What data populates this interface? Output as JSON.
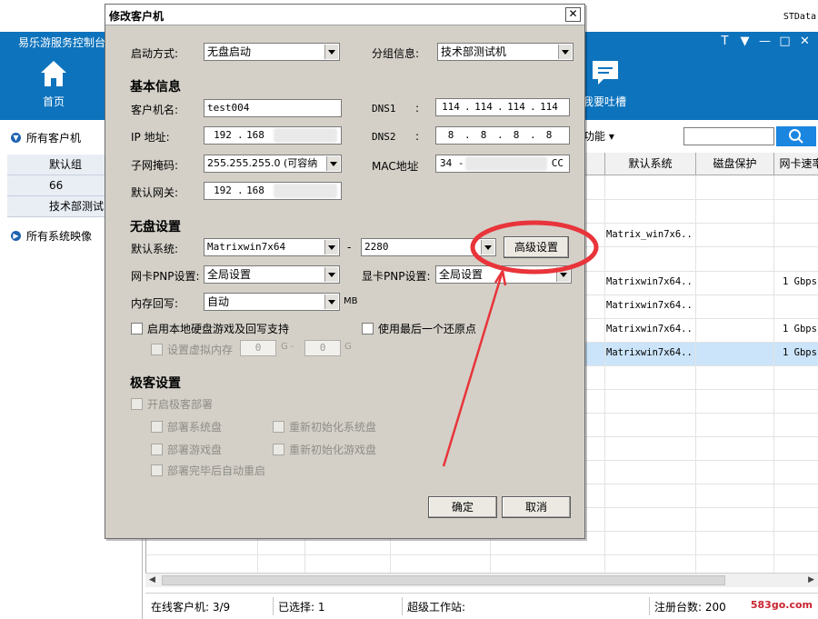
{
  "app": {
    "brand_corner": "STData",
    "title": "易乐游服务控制台",
    "nav": {
      "home": "首页",
      "feedback": "我要吐槽"
    },
    "window_controls": {
      "skin": "T",
      "menu": "▼",
      "minimize": "—",
      "maximize": "□",
      "close": "✕"
    },
    "sidebar": {
      "all_clients": "所有客户机",
      "groups": [
        "默认组",
        "66",
        "技术部测试"
      ],
      "all_images": "所有系统映像"
    },
    "toolbar": {
      "function_menu": "功能 ▾",
      "search_placeholder": ""
    },
    "grid": {
      "headers": [
        "默认系统",
        "磁盘保护",
        "网卡速率"
      ],
      "rows": [
        {
          "system": "",
          "speed": ""
        },
        {
          "system": "Matrix_win7x6...",
          "speed": ""
        },
        {
          "system": "",
          "speed": ""
        },
        {
          "system": "Matrixwin7x64...",
          "speed": "1 Gbps"
        },
        {
          "system": "Matrixwin7x64...",
          "speed": ""
        },
        {
          "system": "Matrixwin7x64...",
          "speed": "1 Gbps"
        },
        {
          "system": "Matrixwin7x64...",
          "speed": "1 Gbps"
        }
      ]
    },
    "statusbar": {
      "online": "在线客户机: 3/9",
      "selected": "已选择: 1",
      "super_ws": "超级工作站:",
      "registered": "注册台数: 200",
      "watermark": "583go.com"
    }
  },
  "dialog": {
    "title": "修改客户机",
    "close": "✕",
    "boot_mode": {
      "label": "启动方式:",
      "value": "无盘启动"
    },
    "group_info": {
      "label": "分组信息:",
      "value": "技术部测试机"
    },
    "basic_section": "基本信息",
    "client_name": {
      "label": "客户机名:",
      "value": "test004"
    },
    "ip": {
      "label": "IP  地址:",
      "octets": [
        "192",
        "168"
      ]
    },
    "subnet": {
      "label": "子网掩码:",
      "value": "255.255.255.0   (可容纳"
    },
    "gateway": {
      "label": "默认网关:",
      "octets": [
        "192",
        "168"
      ]
    },
    "dns1": {
      "label": "DNS1",
      "colon": ":",
      "octets": [
        "114",
        "114",
        "114",
        "114"
      ]
    },
    "dns2": {
      "label": "DNS2",
      "colon": ":",
      "octets": [
        "8",
        "8",
        "8",
        "8"
      ]
    },
    "mac": {
      "label": "MAC地址",
      "colon": ":",
      "start": "34 -",
      "end": "CC"
    },
    "diskless_section": "无盘设置",
    "default_system": {
      "label": "默认系统:",
      "value": "Matrixwin7x64",
      "dash": "-",
      "version": "2280"
    },
    "advanced_button": "高级设置",
    "nic_pnp": {
      "label": "网卡PNP设置:",
      "value": "全局设置"
    },
    "gpu_pnp": {
      "label": "显卡PNP设置:",
      "value": "全局设置"
    },
    "mem_writeback": {
      "label": "内存回写:",
      "value": "自动",
      "unit": "MB"
    },
    "enable_local_disk": "启用本地硬盘游戏及回写支持",
    "use_last_restore": "使用最后一个还原点",
    "virtual_memory": {
      "label": "设置虚拟内存",
      "min": "0",
      "unit1": "G -",
      "max": "0",
      "unit2": "G"
    },
    "extreme_section": "极客设置",
    "enable_extreme": "开启极客部署",
    "deploy_sys": "部署系统盘",
    "reinit_sys": "重新初始化系统盘",
    "deploy_game": "部署游戏盘",
    "reinit_game": "重新初始化游戏盘",
    "auto_restart": "部署完毕后自动重启",
    "ok": "确定",
    "cancel": "取消"
  },
  "colors": {
    "header_blue": "#0d73bd",
    "dialog_bg": "#d4d0c8",
    "annotation_red": "#e8343a",
    "selected_row": "#cbe4f9"
  }
}
